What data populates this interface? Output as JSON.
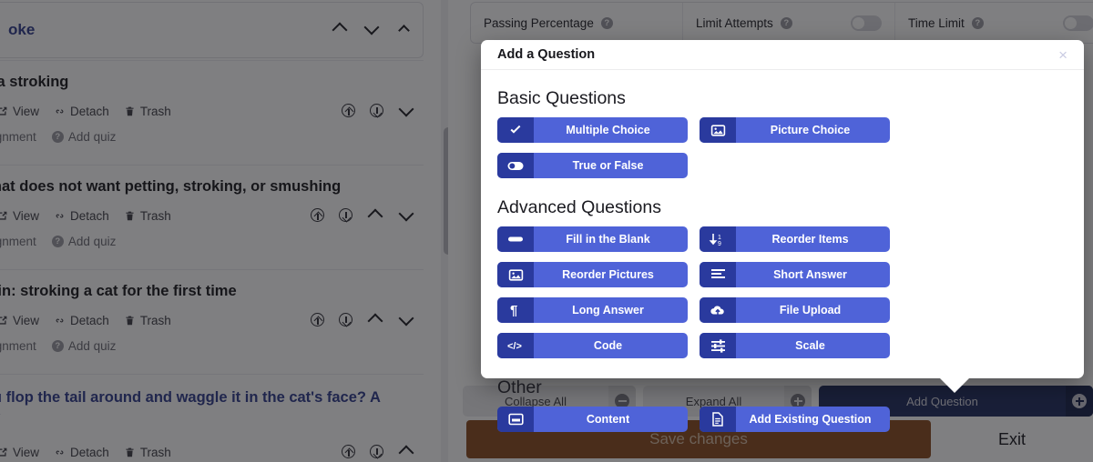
{
  "background": {
    "lessons": [
      {
        "title": "oke",
        "is_link": true,
        "actions": [],
        "sub_actions": []
      },
      {
        "title": "ants a stroking",
        "is_link": false,
        "actions": [
          "View",
          "Detach",
          "Trash"
        ],
        "sub_actions": [
          "dd assignment",
          "Add quiz"
        ]
      },
      {
        "title": "cat that does not want petting, stroking, or smushing",
        "is_link": false,
        "actions": [
          "View",
          "Detach",
          "Trash"
        ],
        "sub_actions": [
          "dd assignment",
          "Add quiz"
        ]
      },
      {
        "title": "e grain: stroking a cat for the first time",
        "is_link": false,
        "actions": [
          "View",
          "Detach",
          "Trash"
        ],
        "sub_actions": [
          "dd assignment",
          "Add quiz"
        ]
      },
      {
        "title": "d you flop the tail around and waggle it in the cat's face? A rview",
        "is_link": true,
        "actions": [
          "View",
          "Detach",
          "Trash"
        ],
        "sub_actions": []
      }
    ],
    "settings": [
      {
        "label": "Passing Percentage",
        "has_toggle": false,
        "toggle_on": false
      },
      {
        "label": "Limit Attempts",
        "has_toggle": true,
        "toggle_on": false
      },
      {
        "label": "Time Limit",
        "has_toggle": true,
        "toggle_on": false
      }
    ],
    "bottom_actions": [
      {
        "label": "Collapse All",
        "icon": "minus-circle-icon",
        "primary": false
      },
      {
        "label": "Expand All",
        "icon": "plus-circle-icon",
        "primary": false
      },
      {
        "label": "Add Question",
        "icon": "plus-circle-icon",
        "primary": true
      }
    ],
    "save_label": "Save changes",
    "exit_label": "Exit"
  },
  "modal": {
    "title": "Add a Question",
    "close_label": "×",
    "sections": [
      {
        "heading": "Basic Questions",
        "buttons": [
          {
            "label": "Multiple Choice",
            "icon": "check-icon"
          },
          {
            "label": "Picture Choice",
            "icon": "image-icon"
          },
          {
            "label": "True or False",
            "icon": "toggle-icon"
          }
        ]
      },
      {
        "heading": "Advanced Questions",
        "buttons": [
          {
            "label": "Fill in the Blank",
            "icon": "blank-bar-icon"
          },
          {
            "label": "Reorder Items",
            "icon": "sort-numeric-icon"
          },
          {
            "label": "Reorder Pictures",
            "icon": "image-icon"
          },
          {
            "label": "Short Answer",
            "icon": "align-left-icon"
          },
          {
            "label": "Long Answer",
            "icon": "paragraph-icon"
          },
          {
            "label": "File Upload",
            "icon": "cloud-upload-icon"
          },
          {
            "label": "Code",
            "icon": "code-icon"
          },
          {
            "label": "Scale",
            "icon": "sliders-icon"
          }
        ]
      },
      {
        "heading": "Other",
        "buttons": [
          {
            "label": "Content",
            "icon": "window-icon"
          },
          {
            "label": "Add Existing Question",
            "icon": "document-icon"
          }
        ]
      }
    ]
  },
  "colors": {
    "button_body": "#4f63d8",
    "button_icon": "#2a3a9e",
    "primary_action": "#1e2a5e",
    "save_button": "#8a4a1d",
    "link_text": "#2e3a8c"
  }
}
